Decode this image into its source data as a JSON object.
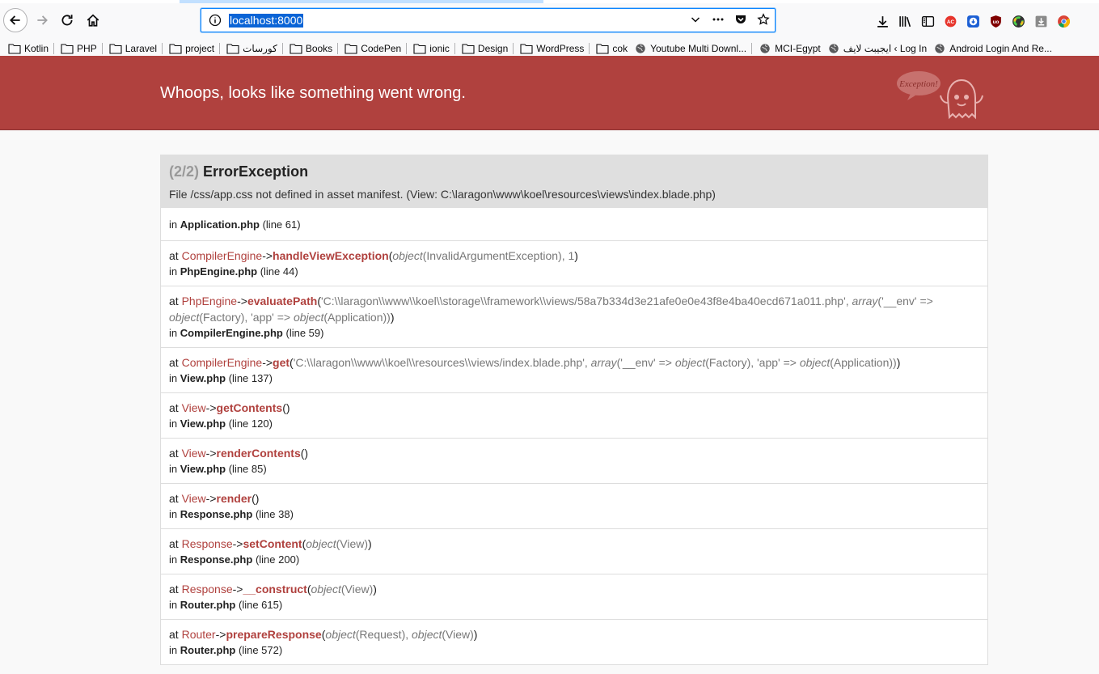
{
  "browser": {
    "url": "localhost:8000",
    "bookmarks": [
      "Kotlin",
      "PHP",
      "Laravel",
      "project",
      "كورسات",
      "Books",
      "CodePen",
      "ionic",
      "Design",
      "WordPress",
      "cok",
      "Youtube Multi Downl...",
      "MCI-Egypt",
      "ايجيبت لايف ‹ Log In",
      "Android Login And Re..."
    ]
  },
  "page": {
    "heading": "Whoops, looks like something went wrong.",
    "ghost_label": "Exception!",
    "exception": {
      "count": "(2/2)",
      "name": "ErrorException",
      "message": "File /css/app.css not defined in asset manifest. (View: C:\\laragon\\www\\koel\\resources\\views\\index.blade.php)"
    },
    "first_frame": {
      "file": "Application.php",
      "line": "(line 61)"
    },
    "frames": [
      {
        "class": "CompilerEngine",
        "method": "handleViewException",
        "args": "<i>object</i>(InvalidArgumentException), 1",
        "file": "PhpEngine.php",
        "line": "(line 44)"
      },
      {
        "class": "PhpEngine",
        "method": "evaluatePath",
        "args": "'C:\\\\laragon\\\\www\\\\koel\\\\storage\\\\framework\\\\views/58a7b334d3e21afe0e0e43f8e4ba40ecd671a011.php', <i>array</i>('__env' => <i>object</i>(Factory), 'app' => <i>object</i>(Application))",
        "file": "CompilerEngine.php",
        "line": "(line 59)"
      },
      {
        "class": "CompilerEngine",
        "method": "get",
        "args": "'C:\\\\laragon\\\\www\\\\koel\\\\resources\\\\views/index.blade.php', <i>array</i>('__env' => <i>object</i>(Factory), 'app' => <i>object</i>(Application))",
        "file": "View.php",
        "line": "(line 137)"
      },
      {
        "class": "View",
        "method": "getContents",
        "args": "",
        "file": "View.php",
        "line": "(line 120)"
      },
      {
        "class": "View",
        "method": "renderContents",
        "args": "",
        "file": "View.php",
        "line": "(line 85)"
      },
      {
        "class": "View",
        "method": "render",
        "args": "",
        "file": "Response.php",
        "line": "(line 38)"
      },
      {
        "class": "Response",
        "method": "setContent",
        "args": "<i>object</i>(View)",
        "file": "Response.php",
        "line": "(line 200)"
      },
      {
        "class": "Response",
        "method": "__construct",
        "args": "<i>object</i>(View)",
        "file": "Router.php",
        "line": "(line 615)"
      },
      {
        "class": "Router",
        "method": "prepareResponse",
        "args": "<i>object</i>(Request), <i>object</i>(View)",
        "file": "Router.php",
        "line": "(line 572)"
      }
    ],
    "labels": {
      "at": "at",
      "in": "in",
      "arrow": "->"
    }
  },
  "colors": {
    "header_bg": "#b0413e",
    "accent": "#b0413e",
    "url_highlight": "#0a64d6"
  }
}
